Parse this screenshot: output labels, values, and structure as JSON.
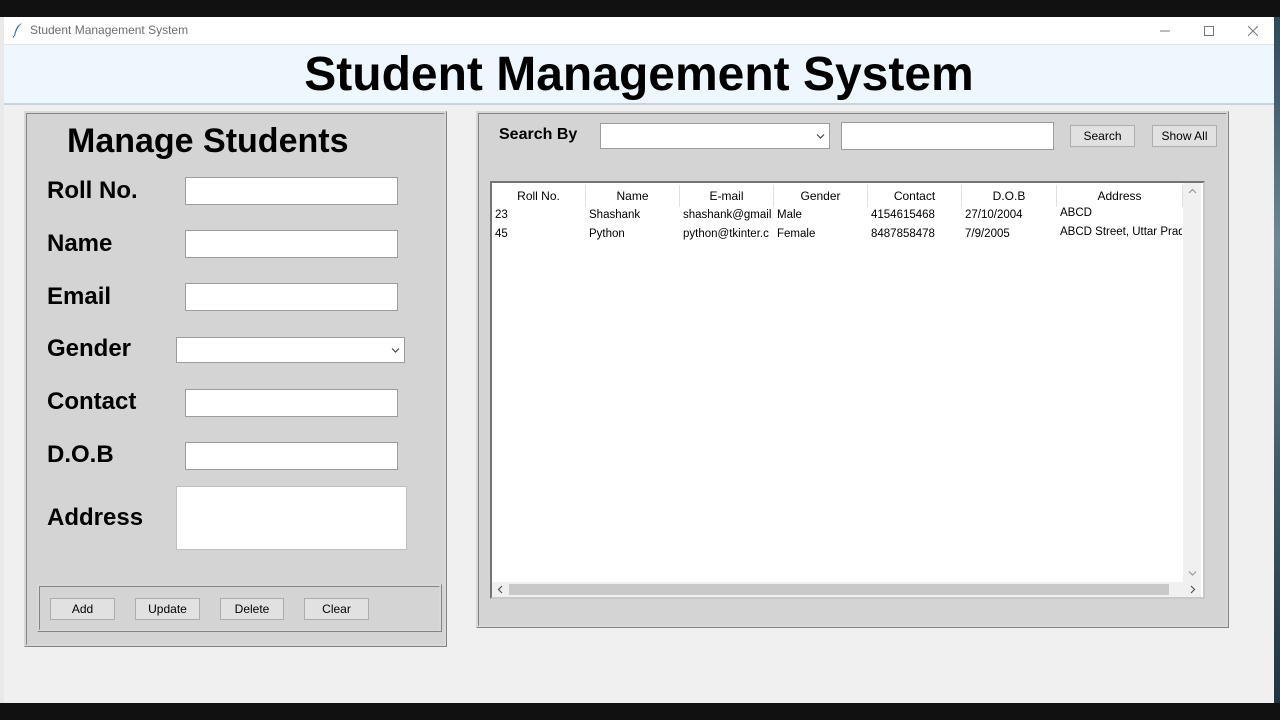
{
  "window": {
    "title": "Student Management System",
    "minimize_icon": "minimize-icon",
    "maximize_icon": "maximize-icon",
    "close_icon": "close-icon"
  },
  "header": {
    "title": "Student Management System"
  },
  "manage": {
    "title": "Manage Students",
    "fields": {
      "roll": {
        "label": "Roll No.",
        "value": ""
      },
      "name": {
        "label": "Name",
        "value": ""
      },
      "email": {
        "label": "Email",
        "value": ""
      },
      "gender": {
        "label": "Gender",
        "value": ""
      },
      "contact": {
        "label": "Contact",
        "value": ""
      },
      "dob": {
        "label": "D.O.B",
        "value": ""
      },
      "address": {
        "label": "Address",
        "value": ""
      }
    },
    "buttons": {
      "add": "Add",
      "update": "Update",
      "delete": "Delete",
      "clear": "Clear"
    }
  },
  "search": {
    "label": "Search By",
    "by_value": "",
    "text_value": "",
    "search_button": "Search",
    "show_all_button": "Show All"
  },
  "table": {
    "columns": [
      "Roll No.",
      "Name",
      "E-mail",
      "Gender",
      "Contact",
      "D.O.B",
      "Address"
    ],
    "rows": [
      [
        "23",
        "Shashank",
        "shashank@gmail.",
        "Male",
        "4154615468",
        "27/10/2004",
        "ABCD"
      ],
      [
        "45",
        "Python",
        "python@tkinter.c",
        "Female",
        "8487858478",
        "7/9/2005",
        "ABCD Street, Uttar Prade"
      ]
    ]
  },
  "colors": {
    "header_bg": "#eef6fe",
    "frame_bg": "#d4d4d4",
    "window_bg": "#f0f0f0"
  }
}
